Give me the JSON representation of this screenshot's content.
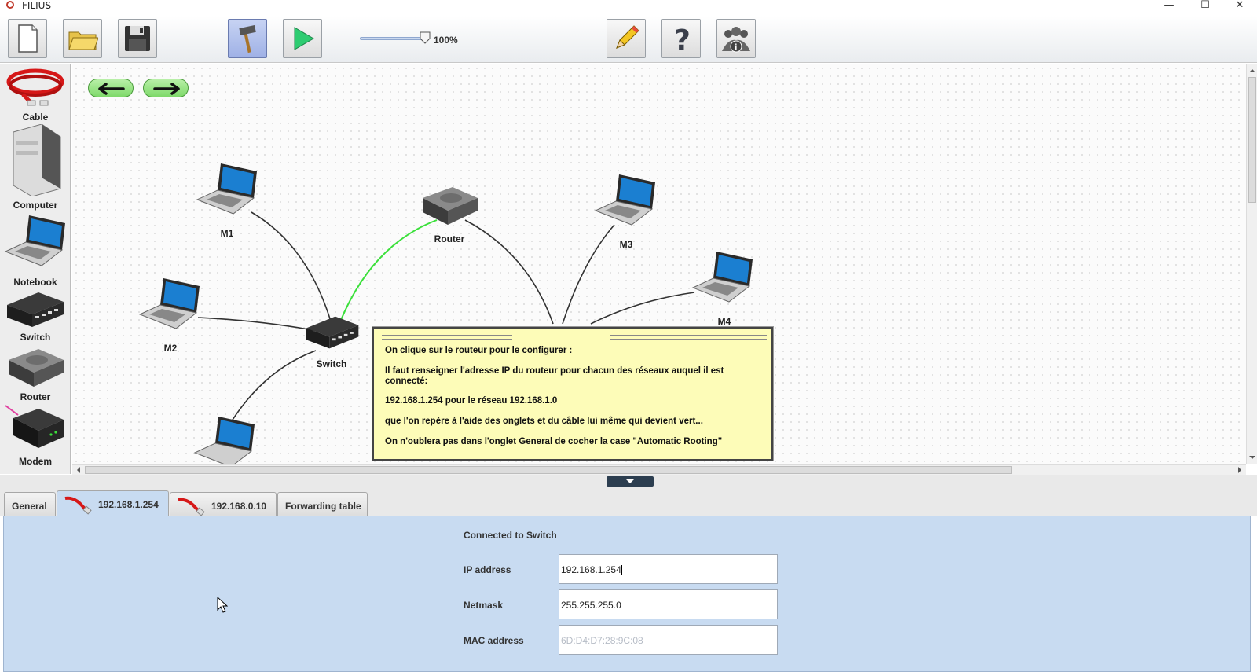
{
  "window": {
    "title": "FILIUS",
    "controls": [
      "minimize",
      "maximize",
      "close"
    ]
  },
  "toolbar": {
    "buttons": [
      {
        "name": "new-file",
        "icon": "new-file-icon"
      },
      {
        "name": "open-folder",
        "icon": "folder-icon"
      },
      {
        "name": "save",
        "icon": "floppy-disk-icon"
      },
      {
        "name": "design-mode",
        "icon": "hammer-icon",
        "active": true
      },
      {
        "name": "simulation-mode",
        "icon": "play-icon"
      },
      {
        "name": "documentation",
        "icon": "pencil-icon"
      },
      {
        "name": "help",
        "icon": "question-mark-icon"
      },
      {
        "name": "about",
        "icon": "info-people-icon"
      }
    ],
    "zoom": {
      "label": "100%",
      "value_percent": 100
    }
  },
  "palette": {
    "items": [
      {
        "label": "Cable",
        "icon": "cable-icon"
      },
      {
        "label": "Computer",
        "icon": "computer-icon"
      },
      {
        "label": "Notebook",
        "icon": "notebook-icon"
      },
      {
        "label": "Switch",
        "icon": "switch-icon"
      },
      {
        "label": "Router",
        "icon": "router-icon"
      },
      {
        "label": "Modem",
        "icon": "modem-icon"
      }
    ]
  },
  "canvas": {
    "nav": {
      "back": "arrow-left-icon",
      "forward": "arrow-right-icon"
    },
    "nodes": [
      {
        "id": "M1",
        "label": "M1",
        "type": "notebook"
      },
      {
        "id": "M2",
        "label": "M2",
        "type": "notebook"
      },
      {
        "id": "M3",
        "label": "M3",
        "type": "notebook"
      },
      {
        "id": "M4",
        "label": "M4",
        "type": "notebook"
      },
      {
        "id": "M5",
        "label": "",
        "type": "notebook"
      },
      {
        "id": "Switch",
        "label": "Switch",
        "type": "switch"
      },
      {
        "id": "Router",
        "label": "Router",
        "type": "router"
      }
    ],
    "note": {
      "lines": [
        "On clique sur le routeur pour le configurer :",
        "Il faut renseigner l'adresse IP du routeur pour chacun des réseaux auquel il est",
        " connecté:",
        "192.168.1.254  pour le réseau 192.168.1.0",
        "que l'on repère à l'aide des onglets et du câble lui même qui devient vert...",
        "On n'oublera pas dans l'onglet General de cocher la case \"Automatic Rooting\""
      ]
    }
  },
  "config": {
    "tabs": [
      {
        "label": "General",
        "icon": ""
      },
      {
        "label": "192.168.1.254",
        "icon": "cable-icon",
        "active": true
      },
      {
        "label": "192.168.0.10",
        "icon": "cable-icon"
      },
      {
        "label": "Forwarding table",
        "icon": ""
      }
    ],
    "connected_to": "Connected to Switch",
    "fields": {
      "ip": {
        "label": "IP address",
        "value": "192.168.1.254"
      },
      "netmask": {
        "label": "Netmask",
        "value": "255.255.255.0"
      },
      "mac": {
        "label": "MAC address",
        "value": "6D:D4:D7:28:9C:08"
      }
    }
  },
  "colors": {
    "active_cable": "#3be03b",
    "cable": "#333333",
    "panel_bg": "#c8dbf1",
    "note_bg": "#fdfcb8"
  }
}
